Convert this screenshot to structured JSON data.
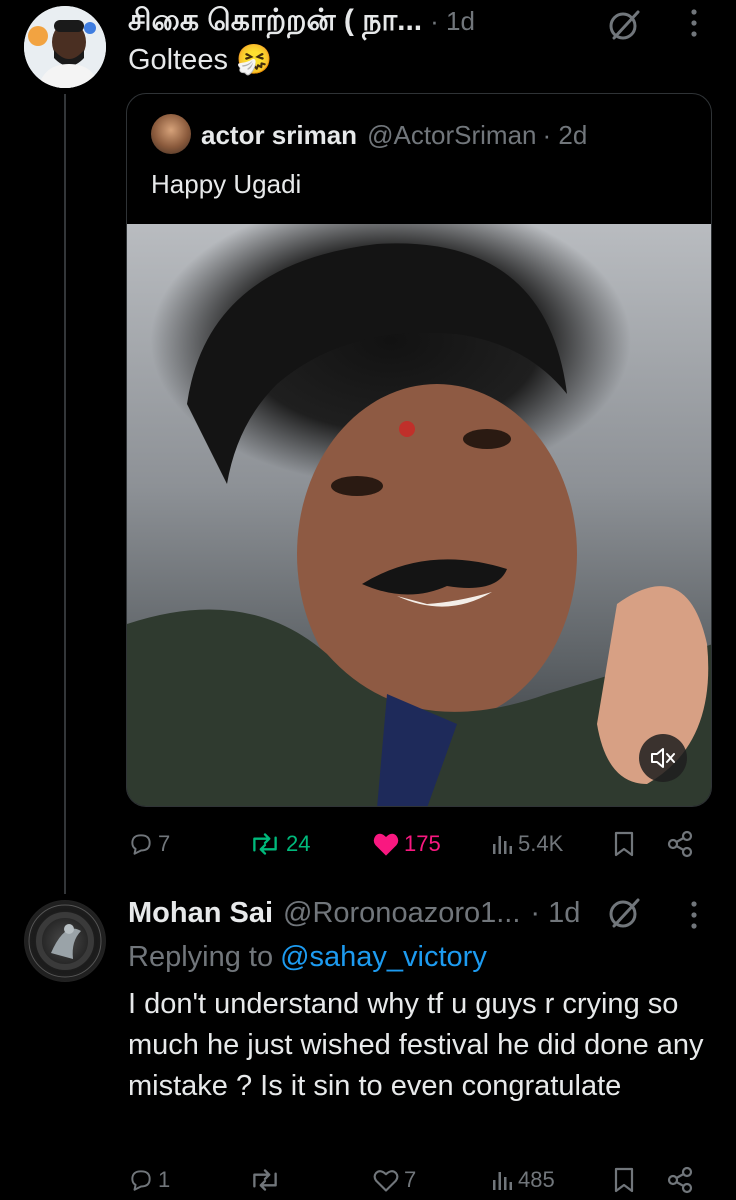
{
  "tweet1": {
    "author_name": "சிகை கொற்றன் ( நா...",
    "time": "· 1d",
    "text": "Goltees 🤧"
  },
  "quote": {
    "author_name": "actor sriman",
    "handle": "@ActorSriman",
    "time": "· 2d",
    "text": "Happy Ugadi"
  },
  "tweet1_actions": {
    "replies": "7",
    "reposts": "24",
    "likes": "175",
    "views": "5.4K"
  },
  "tweet2": {
    "author_name": "Mohan Sai",
    "handle": "@Roronoazoro1...",
    "time": "· 1d",
    "replying_prefix": "Replying to ",
    "replying_handle": "@sahay_victory",
    "text": "I don't understand why tf u guys r crying so much he just wished festival he did done any mistake ? Is it sin to even congratulate"
  },
  "tweet2_actions": {
    "replies": "1",
    "reposts": "",
    "likes": "7",
    "views": "485"
  },
  "colors": {
    "background": "#000000",
    "text": "#e7e9ea",
    "muted": "#71767b",
    "link": "#1d9bf0",
    "repost_green": "#00ba7c",
    "like_pink": "#f91880"
  },
  "icons": [
    "reply-icon",
    "repost-icon",
    "like-icon",
    "views-icon",
    "bookmark-icon",
    "share-icon",
    "grok-icon",
    "more-icon",
    "mute-icon"
  ]
}
